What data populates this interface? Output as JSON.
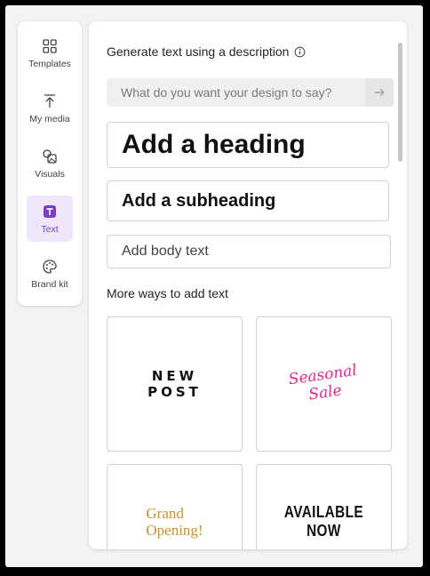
{
  "rail": {
    "items": [
      {
        "label": "Templates",
        "icon": "templates-icon"
      },
      {
        "label": "My media",
        "icon": "upload-icon"
      },
      {
        "label": "Visuals",
        "icon": "visuals-icon"
      },
      {
        "label": "Text",
        "icon": "text-icon",
        "active": true
      },
      {
        "label": "Brand kit",
        "icon": "palette-icon"
      }
    ],
    "active_color": "#7a3ec9"
  },
  "panel": {
    "generate_title": "Generate text using a description",
    "prompt_placeholder": "What do you want your design to say?",
    "heading_label": "Add a heading",
    "subheading_label": "Add a subheading",
    "body_label": "Add body text",
    "more_title": "More ways to add text",
    "tiles": {
      "new_post_1": "NEW",
      "new_post_2": "POST",
      "seasonal_1": "Seasonal",
      "seasonal_2": "Sale",
      "grand_1": "Grand",
      "grand_2": "Opening!",
      "available_1": "AVAILABLE",
      "available_2": "NOW"
    }
  },
  "colors": {
    "seasonal": "#e0288f",
    "grand": "#c9922e"
  }
}
